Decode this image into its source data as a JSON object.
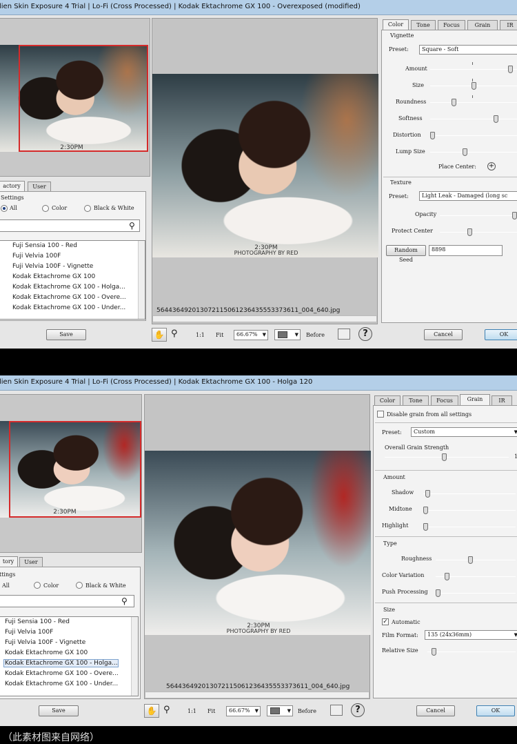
{
  "window1": {
    "title": "lien Skin Exposure 4 Trial | Lo-Fi (Cross Processed) | Kodak Ektachrome GX 100 - Overexposed (modified)",
    "preview_filename": "564436492013072115061236435553373611_004_640.jpg",
    "thumb_time": "2:30PM",
    "thumb_credit": "PHOTOGRAPHY BY RED",
    "tabs": [
      "Color",
      "Tone",
      "Focus",
      "Grain",
      "IR"
    ],
    "active_tab": "Color",
    "vignette": {
      "group": "Vignette",
      "preset_label": "Preset:",
      "preset_value": "Square - Soft",
      "amount": "Amount",
      "size": "Size",
      "roundness": "Roundness",
      "softness": "Softness",
      "distortion": "Distortion",
      "lump_size": "Lump Size",
      "place_center": "Place Center:"
    },
    "sliders": {
      "amount": 0.92,
      "size": 0.49,
      "roundness": 0.25,
      "softness": 0.75,
      "distortion": 0.0,
      "lump_size": 0.38,
      "opacity": 1.0,
      "protect_center": 0.38
    },
    "texture": {
      "group": "Texture",
      "preset_label": "Preset:",
      "preset_value": "Light Leak - Damaged (long sc",
      "opacity": "Opacity",
      "protect_center": "Protect Center"
    },
    "random_seed_label": "Random Seed",
    "random_seed_value": "8898",
    "settings_tabs": [
      "actory",
      "User"
    ],
    "settings_label": "Settings",
    "filter_all": "All",
    "filter_color": "Color",
    "filter_bw": "Black & White",
    "presets": [
      "Fuji Sensia 100 - Red",
      "Fuji Velvia 100F",
      "Fuji Velvia 100F - Vignette",
      "Kodak Ektachrome GX 100",
      "Kodak Ektachrome GX 100 - Holga...",
      "Kodak Ektachrome GX 100 - Overe...",
      "Kodak Ektachrome GX 100 - Under..."
    ],
    "save": "Save",
    "zoom_1to1": "1:1",
    "fit": "Fit",
    "zoom": "66.67%",
    "before": "Before",
    "cancel": "Cancel",
    "ok": "OK"
  },
  "window2": {
    "title": "lien Skin Exposure 4 Trial | Lo-Fi (Cross Processed) | Kodak Ektachrome GX 100 - Holga 120",
    "preview_filename": "564436492013072115061236435553373611_004_640.jpg",
    "thumb_time": "2:30PM",
    "thumb_credit": "PHOTOGRAPHY BY RED",
    "tabs": [
      "Color",
      "Tone",
      "Focus",
      "Grain",
      "IR"
    ],
    "active_tab": "Grain",
    "disable_grain": "Disable grain from all settings",
    "preset_label": "Preset:",
    "preset_value": "Custom",
    "overall_strength": "Overall Grain Strength",
    "overall_value": "1(",
    "amount_group": "Amount",
    "shadow": "Shadow",
    "midtone": "Midtone",
    "highlight": "Highlight",
    "type_group": "Type",
    "roughness": "Roughness",
    "color_variation": "Color Variation",
    "push_processing": "Push Processing",
    "size_group": "Size",
    "automatic": "Automatic",
    "film_format_label": "Film Format:",
    "film_format_value": "135 (24x36mm)",
    "relative_size": "Relative Size",
    "sliders": {
      "overall": 0.48,
      "shadow": 0.02,
      "midtone": 0.0,
      "highlight": 0.0,
      "roughness": 0.43,
      "color_variation": 0.12,
      "push_processing": 0.0,
      "relative_size": 0.05
    },
    "settings_tabs": [
      "tory",
      "User"
    ],
    "settings_label": "ttings",
    "filter_all": "All",
    "filter_color": "Color",
    "filter_bw": "Black & White",
    "presets": [
      "Fuji Sensia 100 - Red",
      "Fuji Velvia 100F",
      "Fuji Velvia 100F - Vignette",
      "Kodak Ektachrome GX 100",
      "Kodak Ektachrome GX 100 - Holga...",
      "Kodak Ektachrome GX 100 - Overe...",
      "Kodak Ektachrome GX 100 - Under..."
    ],
    "selected_preset_index": 4,
    "save": "Save",
    "zoom_1to1": "1:1",
    "fit": "Fit",
    "zoom": "66.67%",
    "before": "Before",
    "cancel": "Cancel",
    "ok": "OK"
  },
  "caption": "（此素材图来自网络）"
}
